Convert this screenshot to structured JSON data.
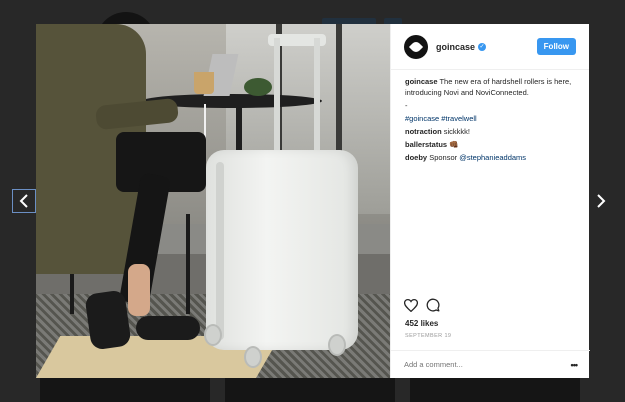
{
  "post": {
    "username": "goincase",
    "follow_label": "Follow",
    "caption_user": "goincase",
    "caption_text": "The new era of hardshell rollers is here, introducing Novi and NoviConnected.",
    "caption_dash": "-",
    "hashtags": [
      "#goincase",
      "#travelwell"
    ],
    "comments": [
      {
        "user": "notraction",
        "text": "sickkkk!"
      },
      {
        "user": "ballerstatus",
        "text": "👊🏾"
      },
      {
        "user": "doeby",
        "text": "Sponsor",
        "mention": "@stephanieaddams"
      }
    ],
    "likes": "452 likes",
    "date": "SEPTEMBER 19",
    "comment_placeholder": "Add a comment...",
    "more_label": "•••"
  },
  "icons": {
    "like": "heart-icon",
    "comment": "comment-icon",
    "prev": "chevron-left-icon",
    "next": "chevron-right-icon",
    "verified": "verified-badge-icon"
  },
  "colors": {
    "accent": "#3897f0",
    "link": "#003569",
    "overlay": "#3d3d3d"
  }
}
